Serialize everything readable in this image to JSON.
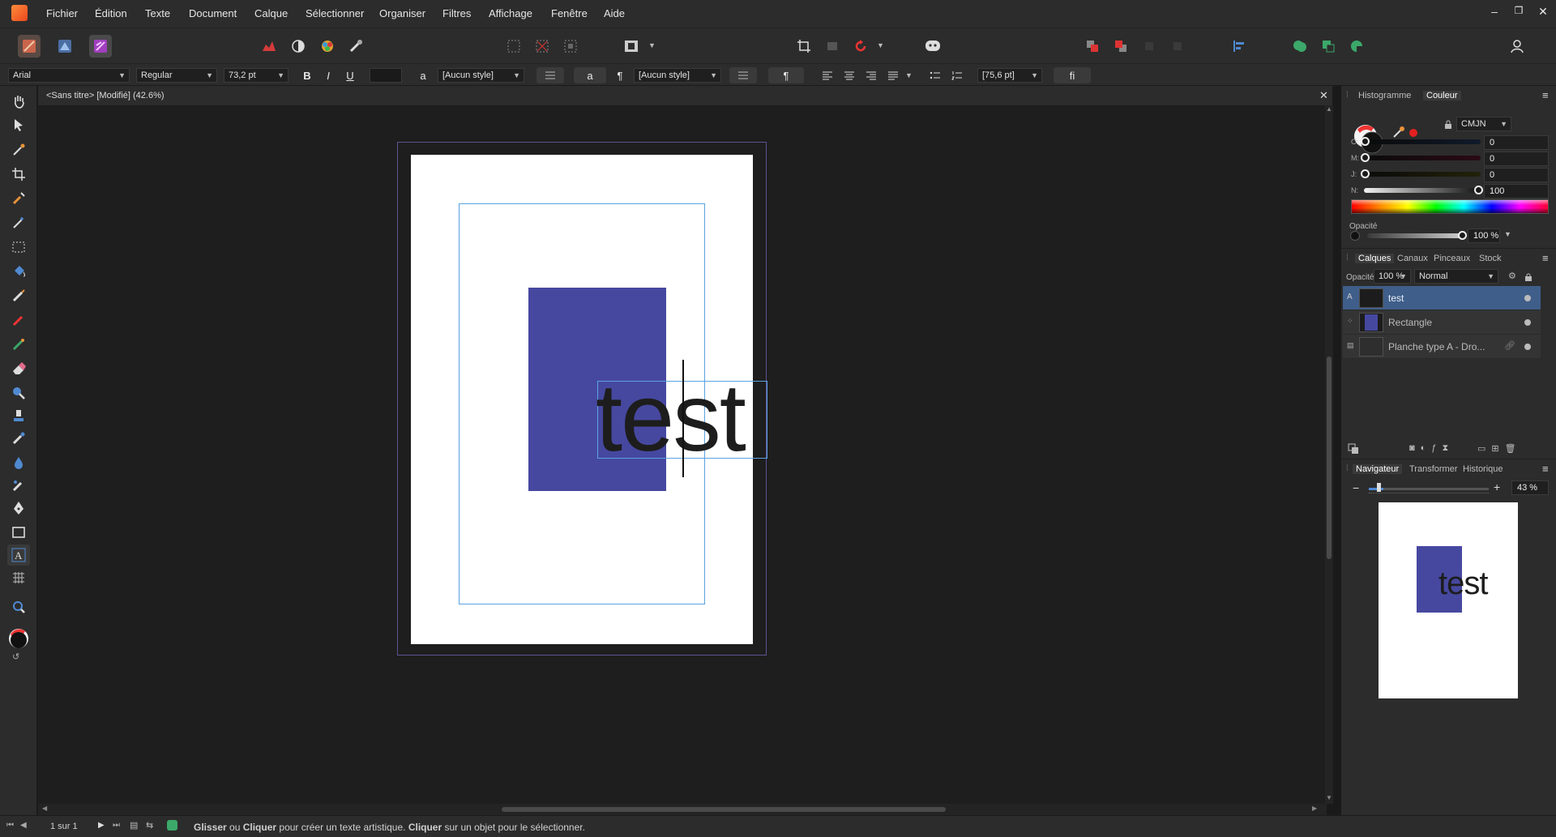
{
  "menu": {
    "items": [
      "Fichier",
      "Édition",
      "Texte",
      "Document",
      "Calque",
      "Sélectionner",
      "Organiser",
      "Filtres",
      "Affichage",
      "Fenêtre",
      "Aide"
    ]
  },
  "context_toolbar": {
    "font_family": "Arial",
    "font_style": "Regular",
    "font_size": "73,2 pt",
    "bold": "B",
    "italic": "I",
    "underline": "U",
    "char_style_glyph": "a",
    "char_style": "[Aucun style]",
    "para_glyph": "¶",
    "para_style": "[Aucun style]",
    "leading": "[75,6 pt]",
    "ligature": "fi"
  },
  "document": {
    "title": "<Sans titre> [Modifié] (42.6%)",
    "artistic_text": "test",
    "rect_color": "#4648a0"
  },
  "right_panel": {
    "color_tabs": [
      "Histogramme",
      "Couleur"
    ],
    "color_mode": "CMJN",
    "channels": [
      {
        "label": "C:",
        "value": "0",
        "pct": 0
      },
      {
        "label": "M:",
        "value": "0",
        "pct": 0
      },
      {
        "label": "J:",
        "value": "0",
        "pct": 0
      },
      {
        "label": "N:",
        "value": "100",
        "pct": 100
      }
    ],
    "opacity_label": "Opacité",
    "opacity_value": "100 %",
    "layers_tabs": [
      "Calques",
      "Canaux",
      "Pinceaux",
      "Stock"
    ],
    "layer_opacity_label": "Opacité:",
    "layer_opacity_value": "100 %",
    "blend_mode": "Normal",
    "layers": [
      {
        "name": "test",
        "selected": true
      },
      {
        "name": "Rectangle",
        "selected": false
      },
      {
        "name": "Planche type A - Dro...",
        "selected": false
      }
    ],
    "nav_tabs": [
      "Navigateur",
      "Transformer",
      "Historique"
    ],
    "zoom_value": "43 %",
    "nav_preview_text": "test"
  },
  "status": {
    "page": "1 sur 1",
    "hint_bold1": "Glisser",
    "hint_1": " ou ",
    "hint_bold2": "Cliquer",
    "hint_2": " pour créer un texte artistique. ",
    "hint_bold3": "Cliquer",
    "hint_3": " sur un objet pour le sélectionner."
  },
  "colors": {
    "accent": "#4f8ad1",
    "selection_blue": "#3f5e8a",
    "rect": "#4648a0",
    "record_red": "#e32020"
  }
}
